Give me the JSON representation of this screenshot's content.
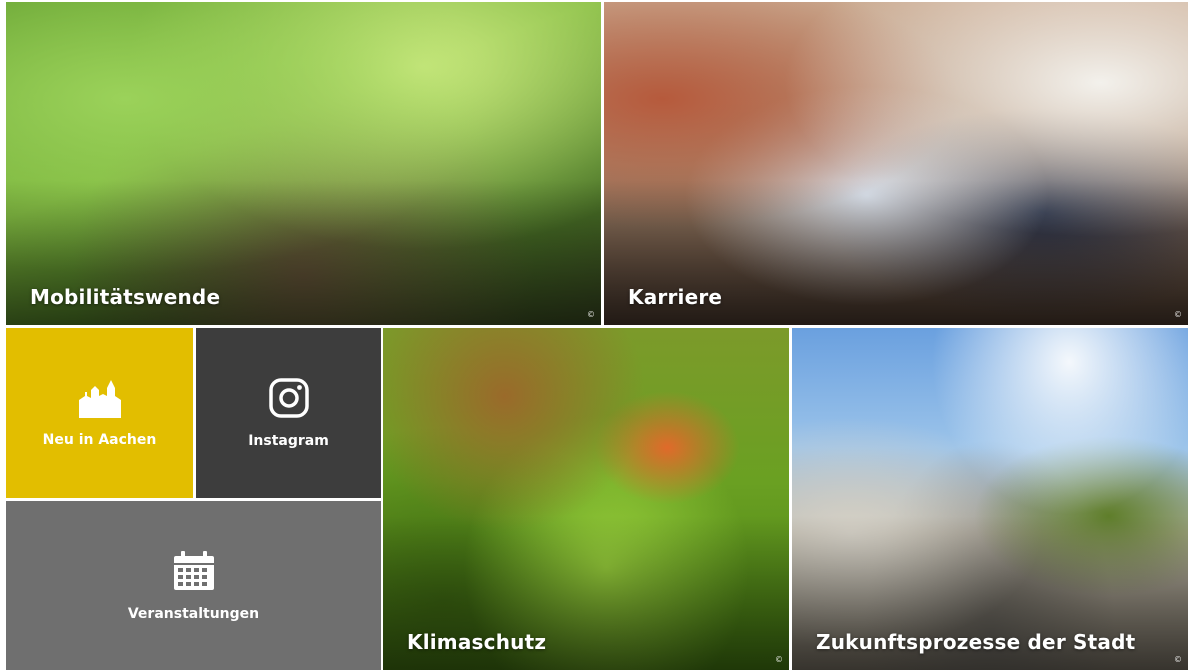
{
  "tiles": {
    "mobilitaetswende": {
      "label": "Mobilitätswende",
      "copyright": "©"
    },
    "karriere": {
      "label": "Karriere",
      "copyright": "©"
    },
    "neu_in_aachen": {
      "label": "Neu in Aachen",
      "icon": "city-silhouette-icon",
      "color": "#e2be00"
    },
    "instagram": {
      "label": "Instagram",
      "icon": "instagram-icon",
      "color": "#3d3d3d"
    },
    "veranstaltungen": {
      "label": "Veranstaltungen",
      "icon": "calendar-icon",
      "color": "#6f6f6f"
    },
    "klimaschutz": {
      "label": "Klimaschutz",
      "copyright": "©"
    },
    "zukunftsprozesse": {
      "label": "Zukunftsprozesse der Stadt",
      "copyright": "©"
    }
  }
}
